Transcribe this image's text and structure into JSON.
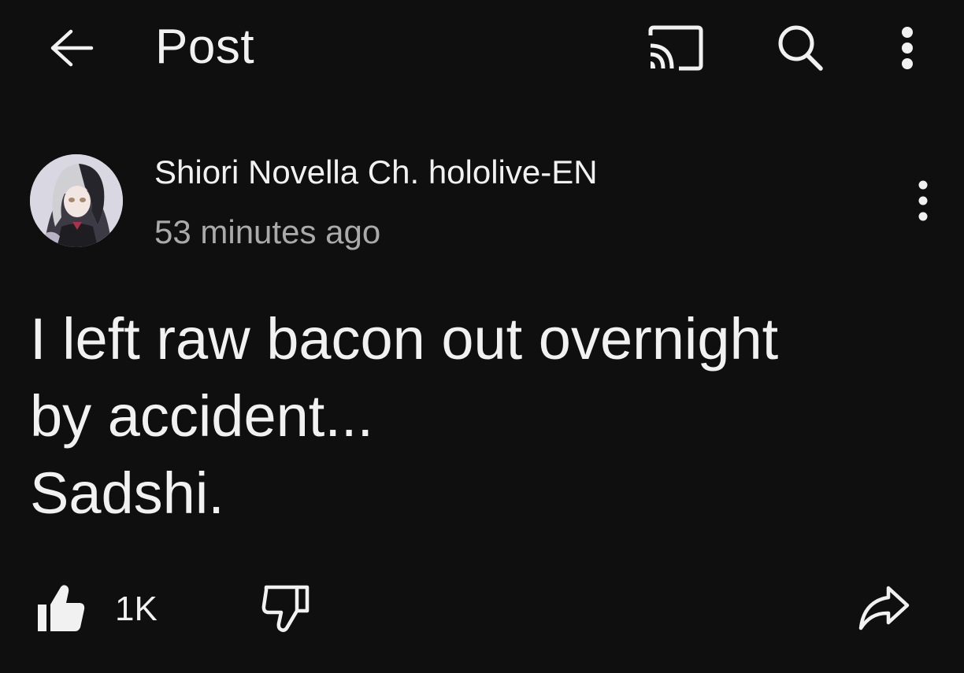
{
  "appbar": {
    "title": "Post",
    "icons": [
      "back-arrow-icon",
      "cast-icon",
      "search-icon",
      "more-vert-icon"
    ]
  },
  "post": {
    "channel_name": "Shiori Novella Ch. hololive-EN",
    "timestamp": "53 minutes ago",
    "text": "I left raw bacon out overnight\nby accident...\nSadshi.",
    "like_count": "1K"
  },
  "colors": {
    "background": "#0f0f0f",
    "primary_text": "#f1f1f1",
    "secondary_text": "#aaaaaa"
  }
}
